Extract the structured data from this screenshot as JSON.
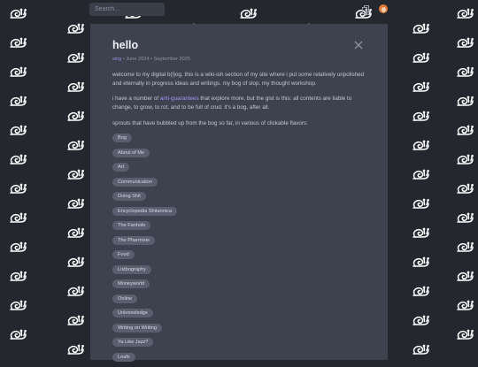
{
  "search": {
    "placeholder": "Search..."
  },
  "header": {
    "copy_icon": "copy-icon",
    "avatar_icon": "avatar-icon"
  },
  "page": {
    "title": "hello",
    "meta": {
      "user": "sing",
      "created": "June 2024",
      "updated": "September 2025",
      "sep": " • "
    },
    "p1": "welcome to my digital b(l)og. this is a wiki-ish section of my site where i put some relatively unpolished and eternally in progress ideas and writings. my bog of slop. my thought workshop.",
    "p2_before": "i have a number of ",
    "p2_link": "anti-guarantees",
    "p2_after": " that explore more, but the gist is this: all contents are liable to change, to grow, to rot, and to be full of crud. it's a bog, after all.",
    "p3": "sprouts that have bubbled up from the bog so far, in various of clickable flavors:",
    "tags": [
      "Bog",
      "About of Me",
      "Art",
      "Communication",
      "Doing Shit",
      "Encyclopedia Shitannica",
      "The Fanhole",
      "The Pharmixie",
      "Food",
      "Listbography",
      "Moneyworld",
      "Online",
      "Unknowledge",
      "Writing on Writing",
      "Ya Like Jazz?",
      "Leafs"
    ]
  },
  "colors": {
    "background": "#24272e",
    "modal": "#3e424f",
    "tag": "#5a5f70",
    "link": "#a694f0",
    "snail": "#ffffff"
  },
  "icons": {
    "pattern": "snail-icon",
    "close": "close-icon"
  }
}
